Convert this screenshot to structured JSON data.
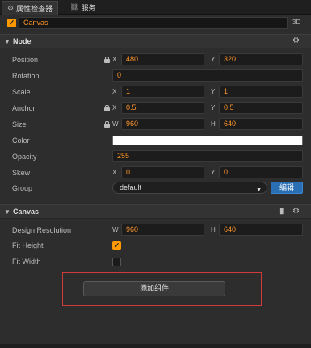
{
  "tabs": [
    {
      "label": "属性检查器",
      "icon": "gear-icon"
    },
    {
      "label": "服务",
      "icon": "link-icon"
    }
  ],
  "node_name": "Canvas",
  "node_active": true,
  "badge_3d": "3D",
  "sections": {
    "node": "Node",
    "canvas": "Canvas"
  },
  "node_props": {
    "position": {
      "label": "Position",
      "x_axis": "X",
      "x": "480",
      "y_axis": "Y",
      "y": "320"
    },
    "rotation": {
      "label": "Rotation",
      "value": "0"
    },
    "scale": {
      "label": "Scale",
      "x_axis": "X",
      "x": "1",
      "y_axis": "Y",
      "y": "1"
    },
    "anchor": {
      "label": "Anchor",
      "x_axis": "X",
      "x": "0.5",
      "y_axis": "Y",
      "y": "0.5"
    },
    "size": {
      "label": "Size",
      "x_axis": "W",
      "x": "960",
      "y_axis": "H",
      "y": "640"
    },
    "color": {
      "label": "Color",
      "value": "#ffffff"
    },
    "opacity": {
      "label": "Opacity",
      "value": "255"
    },
    "skew": {
      "label": "Skew",
      "x_axis": "X",
      "x": "0",
      "y_axis": "Y",
      "y": "0"
    },
    "group": {
      "label": "Group",
      "value": "default",
      "edit_label": "编辑"
    }
  },
  "canvas_props": {
    "design_resolution": {
      "label": "Design Resolution",
      "x_axis": "W",
      "x": "960",
      "y_axis": "H",
      "y": "640"
    },
    "fit_height": {
      "label": "Fit Height",
      "checked": true
    },
    "fit_width": {
      "label": "Fit Width",
      "checked": false
    }
  },
  "add_component_label": "添加组件",
  "colors": {
    "accent": "#fd942b",
    "edit_button": "#2a6fb3",
    "highlight_box": "#cf3a3a"
  }
}
